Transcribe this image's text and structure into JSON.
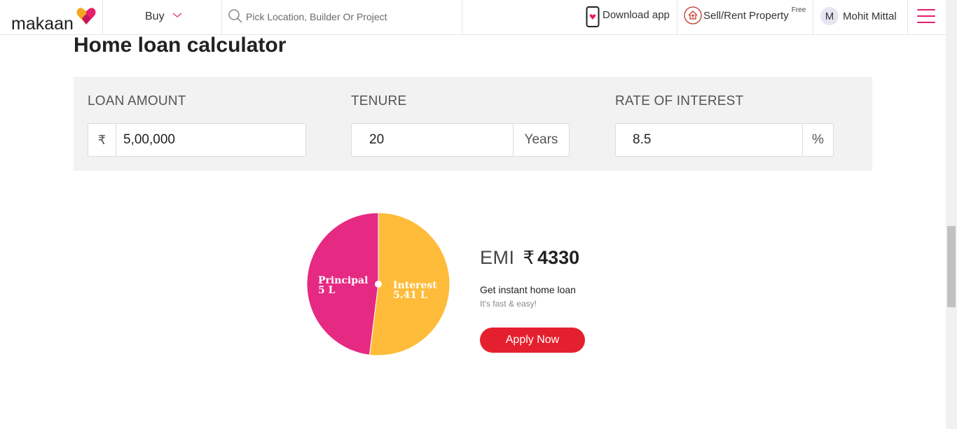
{
  "header": {
    "logo_text": "makaan",
    "buy_label": "Buy",
    "search_placeholder": "Pick Location, Builder Or Project",
    "download_label": "Download app",
    "sell_label": "Sell/Rent Property",
    "sell_badge": "Free",
    "user_initial": "M",
    "user_name": "Mohit Mittal",
    "brand_color": "#e61e6e"
  },
  "main": {
    "title": "Home loan calculator",
    "loan_amount": {
      "label": "LOAN AMOUNT",
      "prefix": "₹",
      "value": "5,00,000"
    },
    "tenure": {
      "label": "TENURE",
      "value": "20",
      "suffix": "Years"
    },
    "rate": {
      "label": "RATE OF INTEREST",
      "value": "8.5",
      "suffix": "%"
    }
  },
  "chart_data": {
    "type": "pie",
    "slices": [
      {
        "name": "Principal",
        "label": "5 L",
        "value": 5.0,
        "color": "#e62983"
      },
      {
        "name": "Interest",
        "label": "5.41 L",
        "value": 5.41,
        "color": "#ffbb3a"
      }
    ]
  },
  "result": {
    "emi_label": "EMI",
    "currency": "₹",
    "emi_value": "4330",
    "instant_text": "Get instant home loan",
    "fast_text": "It's fast & easy!",
    "apply_label": "Apply Now",
    "apply_color": "#e5202e"
  }
}
